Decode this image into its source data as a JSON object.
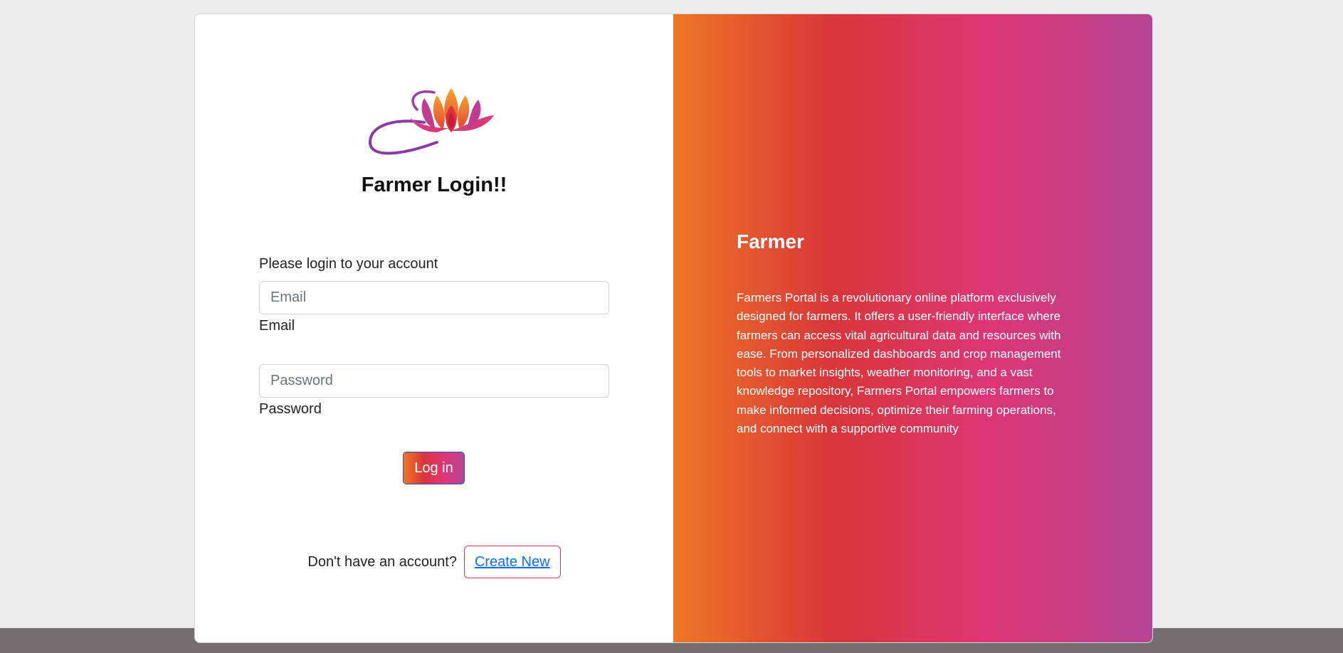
{
  "login": {
    "title": "Farmer Login!!",
    "subtitle": "Please login to your account",
    "email_placeholder": "Email",
    "email_label": "Email",
    "password_placeholder": "Password",
    "password_label": "Password",
    "login_button": "Log in",
    "signup_prompt": "Don't have an account?",
    "create_new_link": "Create New",
    "logo_icon": "lotus-logo-icon"
  },
  "info": {
    "title": "Farmer",
    "description": "Farmers Portal is a revolutionary online platform exclusively designed for farmers. It offers a user-friendly interface where farmers can access vital agricultural data and resources with ease. From personalized dashboards and crop management tools to market insights, weather monitoring, and a vast knowledge repository, Farmers Portal empowers farmers to make informed decisions, optimize their farming operations, and connect with a supportive community"
  },
  "colors": {
    "gradient": [
      "#ee7724",
      "#d8363a",
      "#dd3675",
      "#b44593"
    ],
    "page_background": "#ececec",
    "footer_bar": "#736f70",
    "link": "#0d6efd",
    "create_button_border": "#dc3545"
  }
}
